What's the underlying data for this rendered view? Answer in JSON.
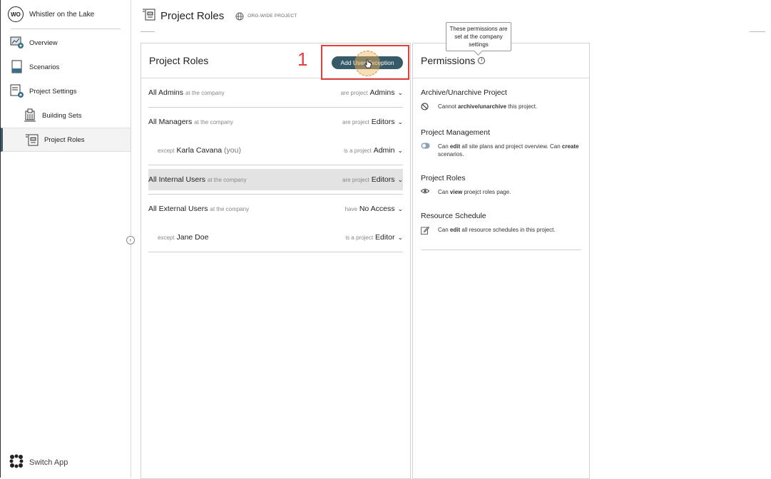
{
  "sidebar": {
    "avatar": "WO",
    "project_name": "Whistler on the Lake",
    "items": [
      {
        "label": "Overview",
        "icon": "overview-icon"
      },
      {
        "label": "Scenarios",
        "icon": "scenarios-icon"
      },
      {
        "label": "Project Settings",
        "icon": "project-settings-icon"
      },
      {
        "label": "Building Sets",
        "icon": "building-sets-icon"
      },
      {
        "label": "Project Roles",
        "icon": "project-roles-icon"
      }
    ],
    "switch_app": "Switch App",
    "collapse_icon": "‹"
  },
  "header": {
    "title": "Project Roles",
    "badge": "ORG-WIDE PROJECT"
  },
  "roles_panel": {
    "title": "Project Roles",
    "add_button": "Add User Exception",
    "annotation_number": "1",
    "groups": [
      {
        "name": "All Admins",
        "scope": "at the company",
        "verb": "are project",
        "role": "Admins"
      },
      {
        "name": "All Managers",
        "scope": "at the company",
        "verb": "are project",
        "role": "Editors",
        "exception": {
          "prefix": "except",
          "name": "Karla Cavana",
          "suffix": "(you)",
          "verb": "is a project",
          "role": "Admin"
        }
      },
      {
        "name": "All Internal Users",
        "scope": "at the company",
        "verb": "are project",
        "role": "Editors"
      },
      {
        "name": "All External Users",
        "scope": "at the company",
        "verb": "have",
        "role": "No Access",
        "exception": {
          "prefix": "except",
          "name": "Jane Doe",
          "verb": "is a project",
          "role": "Editor"
        }
      }
    ]
  },
  "permissions_panel": {
    "title": "Permissions",
    "info_icon": "i",
    "tooltip": "These permissions are set at the company settings",
    "sections": [
      {
        "heading": "Archive/Unarchive Project",
        "pre": "Cannot ",
        "bold": "archive/unarchive",
        "post": " this project."
      },
      {
        "heading": "Project Management",
        "pre": "Can ",
        "bold": "edit",
        "post": " all site plans and project overview. Can ",
        "bold2": "create",
        "post2": " scenarios."
      },
      {
        "heading": "Project Roles",
        "pre": "Can ",
        "bold": "view",
        "post": " proejct roles page."
      },
      {
        "heading": "Resource Schedule",
        "pre": "Can ",
        "bold": "edit",
        "post": " all resource schedules in this project."
      }
    ]
  },
  "colors": {
    "accent": "#375a68",
    "highlight": "#e2403f"
  }
}
